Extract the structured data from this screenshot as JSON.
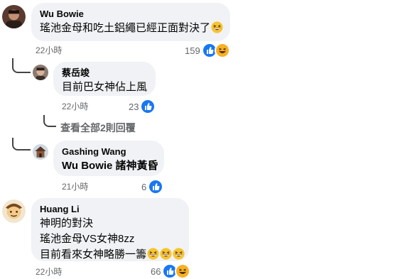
{
  "comments": [
    {
      "author": "Wu Bowie",
      "text": "瑤池金母和吃土鋁繩已經正面對決了",
      "time": "22小時",
      "reaction_count": "159",
      "reactions": [
        "like-icon",
        "haha-icon"
      ],
      "inline_emoji": [
        "grinning-squint-emoji"
      ]
    },
    {
      "author": "蔡岳竣",
      "text": "目前巴女神佔上風",
      "time": "22小時",
      "reaction_count": "23",
      "reactions": [
        "like-icon"
      ]
    },
    {
      "author": "Gashing Wang",
      "text": "Wu Bowie 諸神黃昏",
      "time": "21小時",
      "reaction_count": "6",
      "reactions": [
        "like-icon"
      ]
    },
    {
      "author": "Huang Li",
      "lines": [
        "神明的對決",
        "瑤池金母VS女神8zz",
        "目前看來女神略勝一籌"
      ],
      "time": "22小時",
      "reaction_count": "66",
      "reactions": [
        "like-icon",
        "haha-icon"
      ],
      "inline_emoji": [
        "grinning-squint-emoji",
        "grinning-squint-emoji",
        "grinning-squint-emoji"
      ]
    }
  ],
  "more_replies_label": "查看全部2則回覆",
  "colors": {
    "bubble": "#f0f2f5",
    "meta": "#65676b",
    "like": "#1877f2",
    "haha": "#f7b125"
  }
}
